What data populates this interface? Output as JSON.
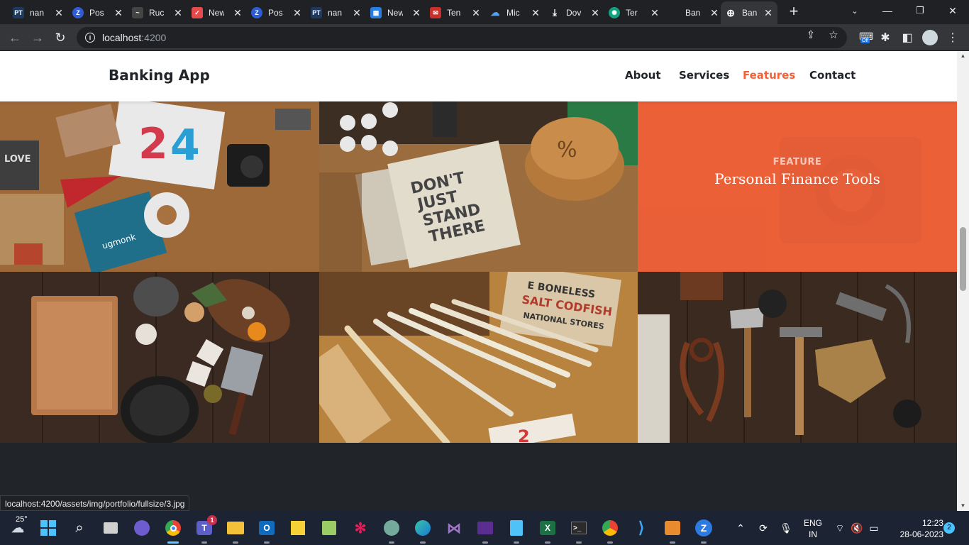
{
  "browser": {
    "tabs": [
      {
        "title": "nan",
        "icon": "pt-icon",
        "color": "#1e3a5f",
        "glyph": "PT"
      },
      {
        "title": "Pos",
        "icon": "z-icon",
        "color": "#2d5cd6",
        "glyph": "Z"
      },
      {
        "title": "Ruc",
        "icon": "signature-icon",
        "color": "#444",
        "glyph": "~"
      },
      {
        "title": "New",
        "icon": "check-shield-icon",
        "color": "#e54b4b",
        "glyph": "✓"
      },
      {
        "title": "Pos",
        "icon": "z-icon",
        "color": "#2d5cd6",
        "glyph": "Z"
      },
      {
        "title": "nan",
        "icon": "pt-icon",
        "color": "#1e3a5f",
        "glyph": "PT"
      },
      {
        "title": "New",
        "icon": "blocks-icon",
        "color": "#2a7de1",
        "glyph": "▦"
      },
      {
        "title": "Ten",
        "icon": "mail-icon",
        "color": "#c9302c",
        "glyph": "✉"
      },
      {
        "title": "Mic",
        "icon": "cloud-icon",
        "color": "#1a73e8",
        "glyph": "☁"
      },
      {
        "title": "Dov",
        "icon": "download-icon",
        "color": "transparent",
        "glyph": "⤓"
      },
      {
        "title": "Ter",
        "icon": "openai-icon",
        "color": "#10a37f",
        "glyph": "✺"
      },
      {
        "title": "Ban",
        "icon": "globe-icon",
        "color": "transparent",
        "glyph": ""
      },
      {
        "title": "Ban",
        "icon": "globe-icon",
        "color": "transparent",
        "glyph": "⊕"
      }
    ],
    "new_tab": "+",
    "url_host": "localhost",
    "url_port": ":4200",
    "status_url": "localhost:4200/assets/img/portfolio/fullsize/3.jpg"
  },
  "site": {
    "brand": "Banking App",
    "nav": {
      "about": "About",
      "services": "Services",
      "features": "Features",
      "contact": "Contact"
    },
    "active_color": "#f4623a",
    "portfolio": [
      {
        "category": "",
        "name": ""
      },
      {
        "category": "",
        "name": ""
      },
      {
        "category": "FEATURE",
        "name": "Personal Finance Tools"
      },
      {
        "category": "",
        "name": ""
      },
      {
        "category": "",
        "name": ""
      },
      {
        "category": "",
        "name": ""
      }
    ]
  },
  "taskbar": {
    "weather": "25°",
    "lang_top": "ENG",
    "lang_bottom": "IN",
    "time": "12:23",
    "date": "28-06-2023",
    "notifications": "2",
    "teams_badge": "1"
  }
}
